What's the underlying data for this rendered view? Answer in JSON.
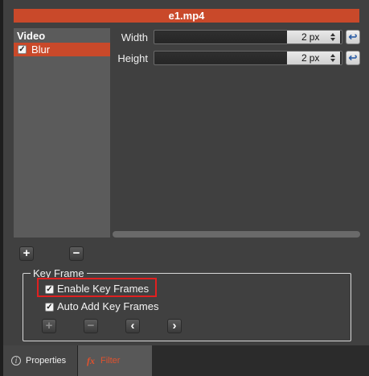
{
  "window": {
    "title": "e1.mp4"
  },
  "filters": {
    "header": "Video",
    "items": [
      {
        "label": "Blur",
        "checked": true
      }
    ]
  },
  "parameters": [
    {
      "label": "Width",
      "value": "2",
      "unit": "px"
    },
    {
      "label": "Height",
      "value": "2",
      "unit": "px"
    }
  ],
  "filter_controls": {
    "add_label": "+",
    "remove_label": "−"
  },
  "keyframe": {
    "legend": "Key Frame",
    "enable_label": "Enable Key Frames",
    "enable_checked": true,
    "auto_add_label": "Auto Add Key Frames",
    "auto_add_checked": true,
    "buttons": {
      "add": "+",
      "remove": "−",
      "prev": "‹",
      "next": "›"
    }
  },
  "tabs": [
    {
      "label": "Properties",
      "icon": "info-icon",
      "active": false
    },
    {
      "label": "Filter",
      "icon": "fx-icon",
      "active": true
    }
  ],
  "colors": {
    "accent": "#c9492a",
    "highlight": "#e02020",
    "tab_active_text": "#e0522e"
  }
}
